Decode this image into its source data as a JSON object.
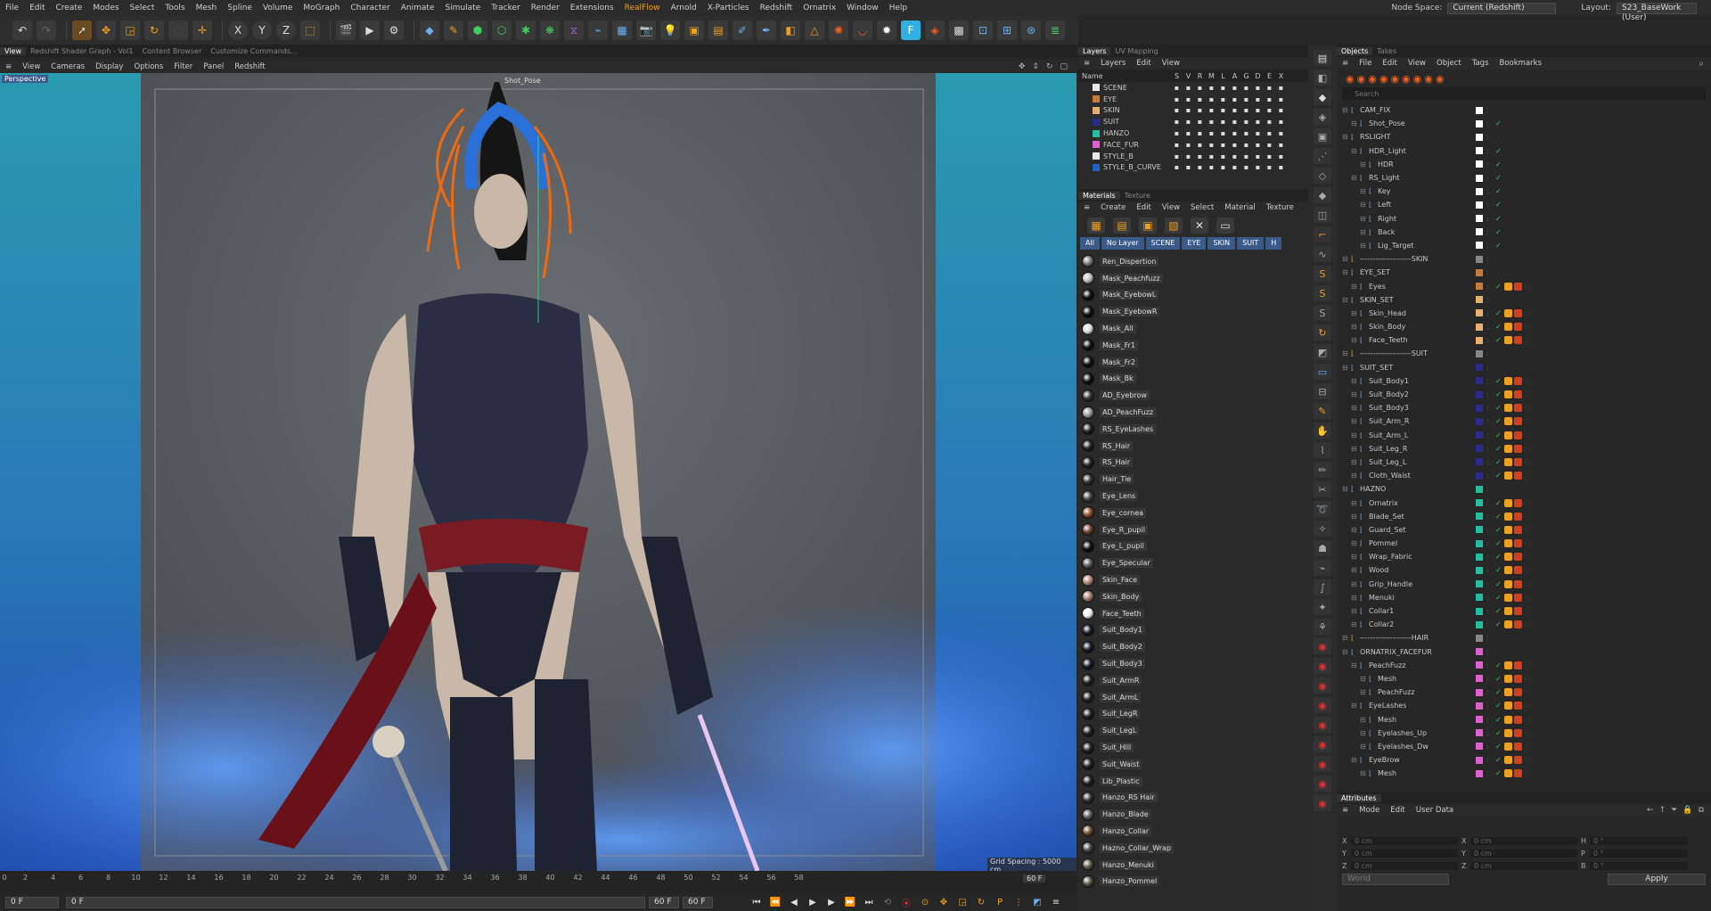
{
  "menu": [
    "File",
    "Edit",
    "Create",
    "Modes",
    "Select",
    "Tools",
    "Mesh",
    "Spline",
    "Volume",
    "MoGraph",
    "Character",
    "Animate",
    "Simulate",
    "Tracker",
    "Render",
    "Extensions",
    "RealFlow",
    "Arnold",
    "X-Particles",
    "Redshift",
    "Ornatrix",
    "Window",
    "Help"
  ],
  "node_space": {
    "label": "Node Space:",
    "value": "Current (Redshift)"
  },
  "layout": {
    "label": "Layout:",
    "value": "S23_BaseWork (User)"
  },
  "viewport_tabs": [
    "View",
    "Redshift Shader Graph - Vol1",
    "Content Browser",
    "Customize Commands..."
  ],
  "viewport_menu": [
    "View",
    "Cameras",
    "Display",
    "Options",
    "Filter",
    "Panel",
    "Redshift"
  ],
  "viewport": {
    "label": "Perspective",
    "camera": "Shot_Pose",
    "grid_spacing": "Grid Spacing : 5000 cm"
  },
  "timeline": {
    "ticks": [
      "0",
      "2",
      "4",
      "6",
      "8",
      "10",
      "12",
      "14",
      "16",
      "18",
      "20",
      "22",
      "24",
      "26",
      "28",
      "30",
      "32",
      "34",
      "36",
      "38",
      "40",
      "42",
      "44",
      "46",
      "48",
      "50",
      "52",
      "54",
      "56",
      "58"
    ],
    "end": "60 F"
  },
  "transport": {
    "current": "0 F",
    "start": "0 F",
    "end1": "60 F",
    "end2": "60 F"
  },
  "layers_panel": {
    "tabs": [
      "Layers",
      "UV Mapping"
    ],
    "menu": [
      "Layers",
      "Edit",
      "View"
    ],
    "header_name": "Name",
    "header_cols": [
      "S",
      "V",
      "R",
      "M",
      "L",
      "A",
      "G",
      "D",
      "E",
      "X"
    ],
    "items": [
      {
        "name": "SCENE",
        "color": "#e8e8e8"
      },
      {
        "name": "EYE",
        "color": "#c87a3a"
      },
      {
        "name": "SKIN",
        "color": "#e8b070"
      },
      {
        "name": "SUIT",
        "color": "#2a2a90"
      },
      {
        "name": "HANZO",
        "color": "#20c0a0"
      },
      {
        "name": "FACE_FUR",
        "color": "#e060d0"
      },
      {
        "name": "STYLE_B",
        "color": "#e8e8e8"
      },
      {
        "name": "STYLE_B_CURVE",
        "color": "#2060c0"
      }
    ]
  },
  "materials_panel": {
    "tabs": [
      "Materials",
      "Texture"
    ],
    "menu": [
      "Create",
      "Edit",
      "View",
      "Select",
      "Material",
      "Texture"
    ],
    "filters": [
      "All",
      "No Layer",
      "SCENE",
      "EYE",
      "SKIN",
      "SUIT",
      "H"
    ],
    "items": [
      {
        "name": "Ren_Dispertion",
        "color": "#777"
      },
      {
        "name": "Mask_Peachfuzz",
        "color": "#bbb"
      },
      {
        "name": "Mask_EyebowL",
        "color": "#111"
      },
      {
        "name": "Mask_EyebowR",
        "color": "#111"
      },
      {
        "name": "Mask_All",
        "color": "#ddd"
      },
      {
        "name": "Mask_Fr1",
        "color": "#111"
      },
      {
        "name": "Mask_Fr2",
        "color": "#111"
      },
      {
        "name": "Mask_Bk",
        "color": "#111"
      },
      {
        "name": "AD_Eyebrow",
        "color": "#333"
      },
      {
        "name": "AD_PeachFuzz",
        "color": "#999"
      },
      {
        "name": "RS_EyeLashes",
        "color": "#222"
      },
      {
        "name": "RS_Hair",
        "color": "#222"
      },
      {
        "name": "RS_Hair",
        "color": "#222"
      },
      {
        "name": "Hair_Tie",
        "color": "#333"
      },
      {
        "name": "Eye_Lens",
        "color": "#444"
      },
      {
        "name": "Eye_cornea",
        "color": "#8a5030"
      },
      {
        "name": "Eye_R_pupil",
        "color": "#6a4030"
      },
      {
        "name": "Eye_L_pupil",
        "color": "#111"
      },
      {
        "name": "Eye_Specular",
        "color": "#555"
      },
      {
        "name": "Skin_Face",
        "color": "#b08070"
      },
      {
        "name": "Skin_Body",
        "color": "#a07868"
      },
      {
        "name": "Face_Teeth",
        "color": "#eee"
      },
      {
        "name": "Suit_Body1",
        "color": "#1a1a2a"
      },
      {
        "name": "Suit_Body2",
        "color": "#1a1a2a"
      },
      {
        "name": "Suit_Body3",
        "color": "#1a1a2a"
      },
      {
        "name": "Suit_ArmR",
        "color": "#222"
      },
      {
        "name": "Suit_ArmL",
        "color": "#222"
      },
      {
        "name": "Suit_LegR",
        "color": "#222"
      },
      {
        "name": "Suit_LegL",
        "color": "#222"
      },
      {
        "name": "Suit_Hill",
        "color": "#222"
      },
      {
        "name": "Suit_Waist",
        "color": "#222"
      },
      {
        "name": "Lib_Plastic",
        "color": "#222"
      },
      {
        "name": "Hanzo_RS Hair",
        "color": "#333"
      },
      {
        "name": "Hanzo_Blade",
        "color": "#555"
      },
      {
        "name": "Hanzo_Collar",
        "color": "#6a4a2a"
      },
      {
        "name": "Hazno_Collar_Wrap",
        "color": "#444"
      },
      {
        "name": "Hanzo_Menuki",
        "color": "#554"
      },
      {
        "name": "Hanzo_Pommel",
        "color": "#554"
      }
    ]
  },
  "objects_panel": {
    "tabs": [
      "Objects",
      "Takes"
    ],
    "menu": [
      "File",
      "Edit",
      "View",
      "Object",
      "Tags",
      "Bookmarks"
    ],
    "search_placeholder": "Search",
    "items": [
      {
        "name": "CAM_FIX",
        "indent": 0,
        "color": "#fff"
      },
      {
        "name": "Shot_Pose",
        "indent": 1,
        "color": "#fff"
      },
      {
        "name": "RSLIGHT",
        "indent": 0,
        "color": "#fff"
      },
      {
        "name": "HDR_Light",
        "indent": 1,
        "color": "#fff"
      },
      {
        "name": "HDR",
        "indent": 2,
        "color": "#fff"
      },
      {
        "name": "RS_Light",
        "indent": 1,
        "color": "#fff"
      },
      {
        "name": "Key",
        "indent": 2,
        "color": "#fff"
      },
      {
        "name": "Left",
        "indent": 2,
        "color": "#fff"
      },
      {
        "name": "Right",
        "indent": 2,
        "color": "#fff"
      },
      {
        "name": "Back",
        "indent": 2,
        "color": "#fff"
      },
      {
        "name": "Lig_Target",
        "indent": 2,
        "color": "#fff"
      },
      {
        "name": "--------------------SKIN",
        "indent": 0,
        "color": "#888"
      },
      {
        "name": "EYE_SET",
        "indent": 0,
        "color": "#c87a3a"
      },
      {
        "name": "Eyes",
        "indent": 1,
        "color": "#c87a3a"
      },
      {
        "name": "SKIN_SET",
        "indent": 0,
        "color": "#e8b070"
      },
      {
        "name": "Skin_Head",
        "indent": 1,
        "color": "#e8b070"
      },
      {
        "name": "Skin_Body",
        "indent": 1,
        "color": "#e8b070"
      },
      {
        "name": "Face_Teeth",
        "indent": 1,
        "color": "#e8b070"
      },
      {
        "name": "--------------------SUIT",
        "indent": 0,
        "color": "#888"
      },
      {
        "name": "SUIT_SET",
        "indent": 0,
        "color": "#2a2a90"
      },
      {
        "name": "Suit_Body1",
        "indent": 1,
        "color": "#2a2a90"
      },
      {
        "name": "Suit_Body2",
        "indent": 1,
        "color": "#2a2a90"
      },
      {
        "name": "Suit_Body3",
        "indent": 1,
        "color": "#2a2a90"
      },
      {
        "name": "Suit_Arm_R",
        "indent": 1,
        "color": "#2a2a90"
      },
      {
        "name": "Suit_Arm_L",
        "indent": 1,
        "color": "#2a2a90"
      },
      {
        "name": "Suit_Leg_R",
        "indent": 1,
        "color": "#2a2a90"
      },
      {
        "name": "Suit_Leg_L",
        "indent": 1,
        "color": "#2a2a90"
      },
      {
        "name": "Cloth_Waist",
        "indent": 1,
        "color": "#2a2a90"
      },
      {
        "name": "HAZNO",
        "indent": 0,
        "color": "#20c0a0"
      },
      {
        "name": "Ornatrix",
        "indent": 1,
        "color": "#20c0a0"
      },
      {
        "name": "Blade_Set",
        "indent": 1,
        "color": "#20c0a0"
      },
      {
        "name": "Guard_Set",
        "indent": 1,
        "color": "#20c0a0"
      },
      {
        "name": "Pommel",
        "indent": 1,
        "color": "#20c0a0"
      },
      {
        "name": "Wrap_Fabric",
        "indent": 1,
        "color": "#20c0a0"
      },
      {
        "name": "Wood",
        "indent": 1,
        "color": "#20c0a0"
      },
      {
        "name": "Grip_Handle",
        "indent": 1,
        "color": "#20c0a0"
      },
      {
        "name": "Menuki",
        "indent": 1,
        "color": "#20c0a0"
      },
      {
        "name": "Collar1",
        "indent": 1,
        "color": "#20c0a0"
      },
      {
        "name": "Collar2",
        "indent": 1,
        "color": "#20c0a0"
      },
      {
        "name": "--------------------HAIR",
        "indent": 0,
        "color": "#888"
      },
      {
        "name": "ORNATRIX_FACEFUR",
        "indent": 0,
        "color": "#e060d0"
      },
      {
        "name": "PeachFuzz",
        "indent": 1,
        "color": "#e060d0"
      },
      {
        "name": "Mesh",
        "indent": 2,
        "color": "#e060d0"
      },
      {
        "name": "PeachFuzz",
        "indent": 2,
        "color": "#e060d0"
      },
      {
        "name": "EyeLashes",
        "indent": 1,
        "color": "#e060d0"
      },
      {
        "name": "Mesh",
        "indent": 2,
        "color": "#e060d0"
      },
      {
        "name": "Eyelashes_Up",
        "indent": 2,
        "color": "#e060d0"
      },
      {
        "name": "Eyelashes_Dw",
        "indent": 2,
        "color": "#e060d0"
      },
      {
        "name": "EyeBrow",
        "indent": 1,
        "color": "#e060d0"
      },
      {
        "name": "Mesh",
        "indent": 2,
        "color": "#e060d0"
      }
    ]
  },
  "attributes_panel": {
    "title": "Attributes",
    "menu": [
      "Mode",
      "Edit",
      "User Data"
    ],
    "fields": [
      {
        "label": "X",
        "value": "0 cm",
        "label2": "X",
        "value2": "0 cm",
        "label3": "H",
        "value3": "0 °"
      },
      {
        "label": "Y",
        "value": "0 cm",
        "label2": "Y",
        "value2": "0 cm",
        "label3": "P",
        "value3": "0 °"
      },
      {
        "label": "Z",
        "value": "0 cm",
        "label2": "Z",
        "value2": "0 cm",
        "label3": "B",
        "value3": "0 °"
      }
    ],
    "coord_mode": "World",
    "apply_label": "Apply"
  },
  "colors": {
    "accent": "#f0a020",
    "selection": "#3a5a8a",
    "bg": "#262626"
  }
}
